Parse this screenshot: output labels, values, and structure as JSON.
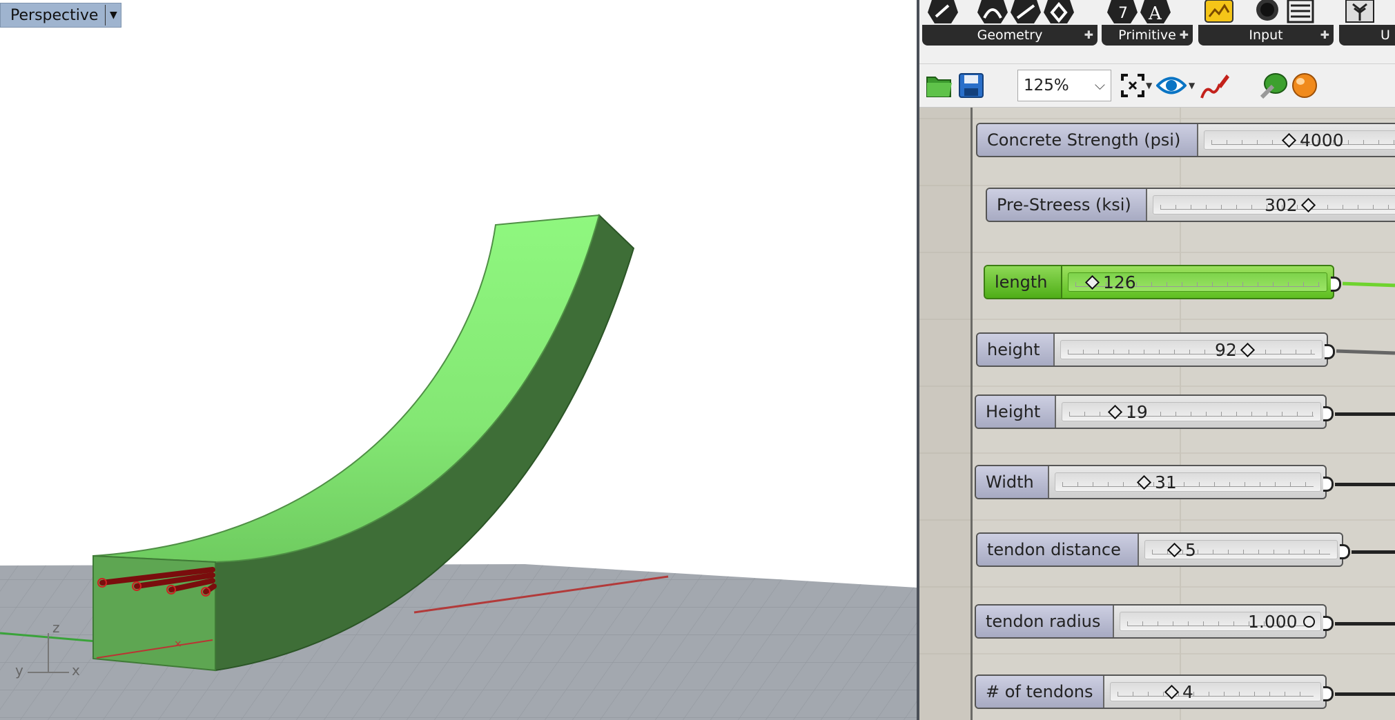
{
  "viewport": {
    "label": "Perspective",
    "axis_labels": {
      "z": "z",
      "y": "y",
      "x": "x"
    }
  },
  "ribbon": {
    "groups": [
      {
        "label": "Geometry"
      },
      {
        "label": "Primitive"
      },
      {
        "label": "Input"
      },
      {
        "label": "U"
      }
    ]
  },
  "toolbar": {
    "zoom": "125%"
  },
  "sliders": [
    {
      "label": "Concrete Strength (psi)",
      "value": "4000"
    },
    {
      "label": "Pre-Streess (ksi)",
      "value": "302"
    },
    {
      "label": "length",
      "value": "126"
    },
    {
      "label": "height",
      "value": "92"
    },
    {
      "label": "Height",
      "value": "19"
    },
    {
      "label": "Width",
      "value": "31"
    },
    {
      "label": "tendon distance",
      "value": "5"
    },
    {
      "label": "tendon radius",
      "value": "1.000"
    },
    {
      "label": "# of tendons",
      "value": "4"
    }
  ]
}
